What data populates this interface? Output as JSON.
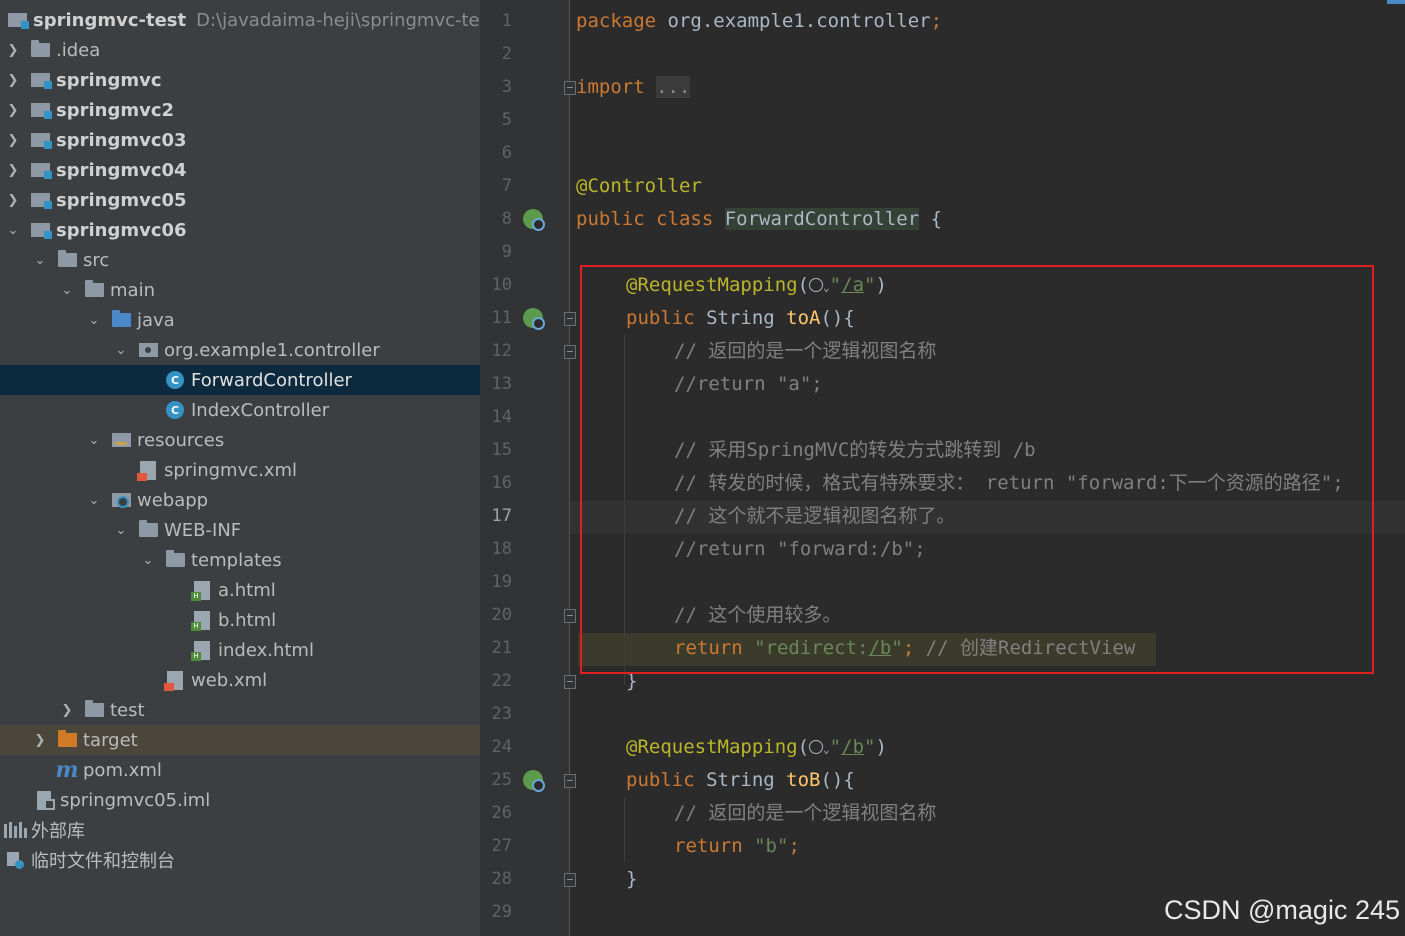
{
  "project": {
    "root_name": "springmvc-test",
    "root_path": "D:\\javadaima-heji\\springmvc-test",
    "items": [
      {
        "label": ".idea",
        "icon": "folder-icon"
      },
      {
        "label": "springmvc",
        "icon": "module-icon"
      },
      {
        "label": "springmvc2",
        "icon": "module-icon"
      },
      {
        "label": "springmvc03",
        "icon": "module-icon"
      },
      {
        "label": "springmvc04",
        "icon": "module-icon"
      },
      {
        "label": "springmvc05",
        "icon": "module-icon"
      },
      {
        "label": "springmvc06",
        "icon": "module-icon"
      },
      {
        "label": "src",
        "icon": "folder-icon"
      },
      {
        "label": "main",
        "icon": "folder-icon"
      },
      {
        "label": "java",
        "icon": "source-folder-icon"
      },
      {
        "label": "org.example1.controller",
        "icon": "package-icon"
      },
      {
        "label": "ForwardController",
        "icon": "class-icon"
      },
      {
        "label": "IndexController",
        "icon": "class-icon"
      },
      {
        "label": "resources",
        "icon": "resources-folder-icon"
      },
      {
        "label": "springmvc.xml",
        "icon": "xml-file-icon"
      },
      {
        "label": "webapp",
        "icon": "web-folder-icon"
      },
      {
        "label": "WEB-INF",
        "icon": "folder-icon"
      },
      {
        "label": "templates",
        "icon": "folder-icon"
      },
      {
        "label": "a.html",
        "icon": "html-file-icon"
      },
      {
        "label": "b.html",
        "icon": "html-file-icon"
      },
      {
        "label": "index.html",
        "icon": "html-file-icon"
      },
      {
        "label": "web.xml",
        "icon": "xml-file-icon"
      },
      {
        "label": "test",
        "icon": "folder-icon"
      },
      {
        "label": "target",
        "icon": "excluded-folder-icon"
      },
      {
        "label": "pom.xml",
        "icon": "maven-icon"
      },
      {
        "label": "springmvc05.iml",
        "icon": "iml-file-icon"
      },
      {
        "label": "外部库",
        "icon": "libraries-icon"
      },
      {
        "label": "临时文件和控制台",
        "icon": "scratches-icon"
      }
    ]
  },
  "editor": {
    "current_line": "17",
    "line_numbers": [
      "1",
      "2",
      "3",
      "5",
      "6",
      "7",
      "8",
      "9",
      "10",
      "11",
      "12",
      "13",
      "14",
      "15",
      "16",
      "17",
      "18",
      "19",
      "20",
      "21",
      "22",
      "23",
      "24",
      "25",
      "26",
      "27",
      "28",
      "29"
    ],
    "code": {
      "l1_kw": "package ",
      "l1_rest": "org.example1.controller",
      "l1_semi": ";",
      "l3_kw": "import ",
      "l3_fold": "...",
      "l7_an": "@Controller",
      "l8_kw": "public class ",
      "l8_cls": "ForwardController",
      "l8_rest": " {",
      "l10_an": "@RequestMapping",
      "l10_open": "(",
      "l10_q1": "\"",
      "l10_path": "/a",
      "l10_q2": "\"",
      "l10_close": ")",
      "l11_kw": "public ",
      "l11_type": "String ",
      "l11_fn": "toA",
      "l11_rest": "(){",
      "l12_cm": "// 返回的是一个逻辑视图名称",
      "l13_cm": "//return \"a\";",
      "l15_cm": "// 采用SpringMVC的转发方式跳转到 /b",
      "l16_cm": "// 转发的时候，格式有特殊要求： return \"forward:下一个资源的路径\";",
      "l17_cm": "// 这个就不是逻辑视图名称了。",
      "l18_cm": "//return \"forward:/b\";",
      "l20_cm": "// 这个使用较多。",
      "l21_kw": "return ",
      "l21_str1": "\"redirect:",
      "l21_path": "/b",
      "l21_str2": "\"",
      "l21_semi": ";",
      "l21_cm": " // 创建RedirectView",
      "l22": "}",
      "l24_an": "@RequestMapping",
      "l24_open": "(",
      "l24_q1": "\"",
      "l24_path": "/b",
      "l24_q2": "\"",
      "l24_close": ")",
      "l25_kw": "public ",
      "l25_type": "String ",
      "l25_fn": "toB",
      "l25_rest": "(){",
      "l26_cm": "// 返回的是一个逻辑视图名称",
      "l27_kw": "return ",
      "l27_str1": "\"",
      "l27_b": "b",
      "l27_str2": "\"",
      "l27_semi": ";",
      "l28": "}"
    }
  },
  "watermark": "CSDN @magic 245",
  "colors": {
    "highlight_box": "#e02020",
    "selection": "#0d293e",
    "keyword": "#cc7832",
    "annotation": "#bbb529",
    "string": "#6a8759",
    "comment": "#808080"
  }
}
